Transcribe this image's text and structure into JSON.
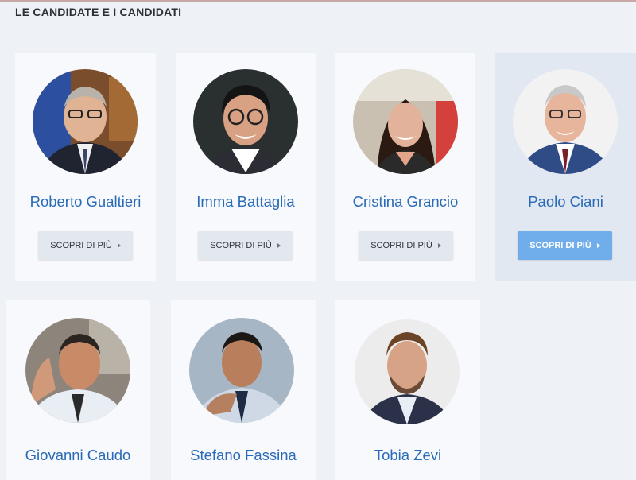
{
  "section": {
    "title": "LE CANDIDATE E I CANDIDATI"
  },
  "accent_color": "#2a6bb8",
  "button_active_color": "#6fadeb",
  "candidates": [
    {
      "name": "Roberto Gualtieri",
      "button": "SCOPRI DI PIÙ",
      "icon": "photo-avatar"
    },
    {
      "name": "Imma Battaglia",
      "button": "SCOPRI DI PIÙ",
      "icon": "photo-avatar"
    },
    {
      "name": "Cristina Grancio",
      "button": "SCOPRI DI PIÙ",
      "icon": "photo-avatar"
    },
    {
      "name": "Paolo Ciani",
      "button": "SCOPRI DI PIÙ",
      "icon": "photo-avatar",
      "highlighted": true
    },
    {
      "name": "Giovanni Caudo",
      "icon": "photo-avatar"
    },
    {
      "name": "Stefano Fassina",
      "icon": "photo-avatar"
    },
    {
      "name": "Tobia Zevi",
      "icon": "photo-avatar"
    }
  ]
}
